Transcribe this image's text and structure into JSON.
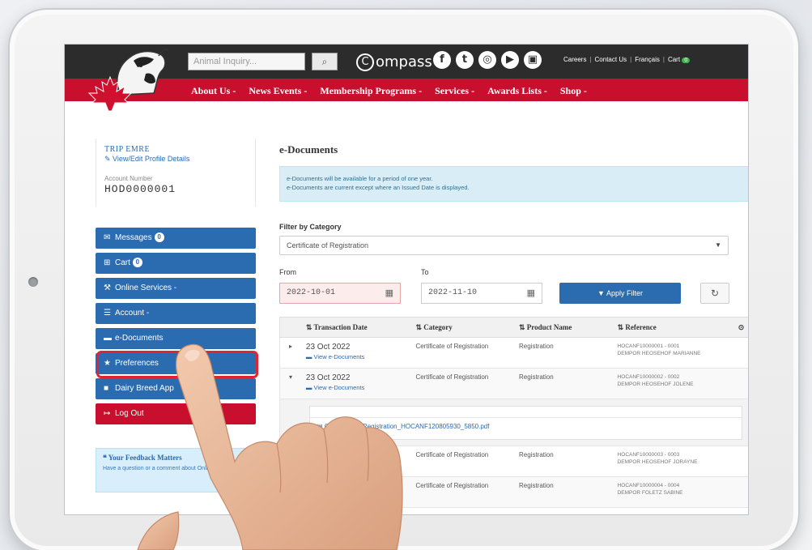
{
  "header": {
    "search_placeholder": "Animal Inquiry...",
    "brand": "ompass",
    "brand_initial": "C",
    "social": [
      "f",
      "t",
      "ig",
      "▶",
      "in"
    ],
    "top_links": [
      "Careers",
      "Contact Us",
      "Français",
      "Cart"
    ],
    "cart_count": "0",
    "nav": [
      "About Us -",
      "News Events -",
      "Membership Programs -",
      "Services -",
      "Awards Lists -",
      "Shop -"
    ]
  },
  "profile": {
    "name": "TRIP EMRE",
    "edit_label": "View/Edit Profile Details",
    "account_label": "Account Number",
    "account_number": "HOD0000001"
  },
  "sidebar": {
    "items": [
      {
        "label": "Messages",
        "badge": "0",
        "icon": "envelope-icon"
      },
      {
        "label": "Cart",
        "badge": "0",
        "icon": "cart-icon"
      },
      {
        "label": "Online Services -",
        "icon": "wrench-icon"
      },
      {
        "label": "Account -",
        "icon": "list-icon"
      },
      {
        "label": "e-Documents",
        "icon": "folder-icon"
      },
      {
        "label": "Preferences",
        "icon": "star-icon"
      },
      {
        "label": "Dairy Breed App",
        "icon": "square-icon"
      },
      {
        "label": "Log Out",
        "icon": "signout-icon"
      }
    ],
    "feedback_title": "Your Feedback Matters",
    "feedback_text": "Have a question or a comment about Online Services?"
  },
  "main": {
    "title": "e-Documents",
    "alert_line1": "e-Documents will be available for a period of one year.",
    "alert_line2": "e-Documents are current except where an Issued Date is displayed.",
    "filter_label": "Filter by Category",
    "category_value": "Certificate of Registration",
    "from_label": "From",
    "to_label": "To",
    "from_value": "2022-10-01",
    "to_value": "2022-11-10",
    "apply_label": "Apply Filter"
  },
  "table": {
    "headers": [
      "Transaction Date",
      "Category",
      "Product Name",
      "Reference"
    ],
    "rows": [
      {
        "date": "23 Oct 2022",
        "link": "View e-Documents",
        "category": "Certificate of Registration",
        "product": "Registration",
        "ref1": "HOCANF10000001 - 0001",
        "ref2": "DEMPOR HEOSEHOF MARIANNE"
      },
      {
        "date": "23 Oct 2022",
        "link": "View e-Documents",
        "category": "Certificate of Registration",
        "product": "Registration",
        "ref1": "HOCANF10000002 - 0002",
        "ref2": "DEMPOR HEOSEHOF JOLENE"
      },
      {
        "date": "",
        "link": "",
        "category": "Certificate of Registration",
        "product": "Registration",
        "ref1": "HOCANF10000003 - 0003",
        "ref2": "DEMPOR HEOSEHOF JORAYNE"
      },
      {
        "date": "",
        "link": "",
        "category": "Certificate of Registration",
        "product": "Registration",
        "ref1": "HOCANF10000004 - 0004",
        "ref2": "DEMPOR FOLETZ SABINE"
      }
    ],
    "attachment": "Certificate of Registration_HOCANF120805930_5850.pdf"
  }
}
